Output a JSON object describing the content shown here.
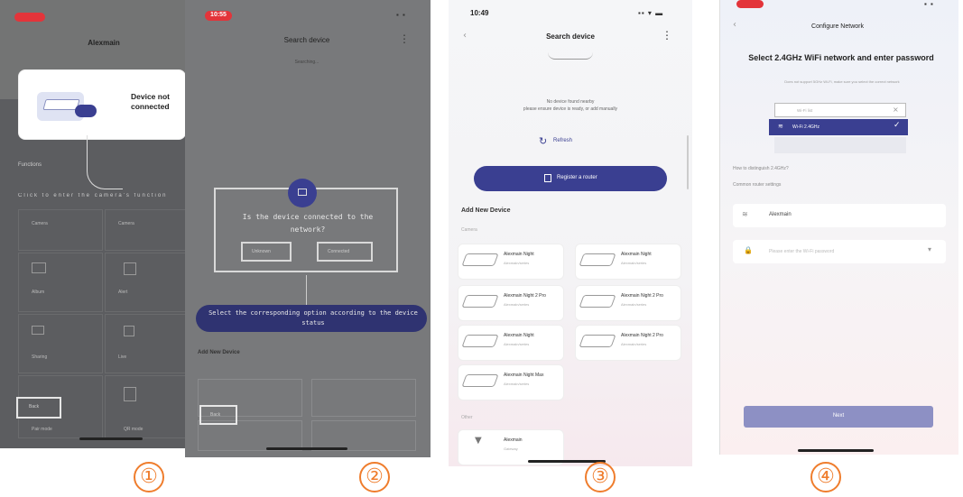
{
  "panel1": {
    "header_title": "Alexmain",
    "popup_title": "Device not connected",
    "section_title": "Functions",
    "hint": "Click to enter the camera's function",
    "tiles": [
      "Camera",
      "Camera",
      "Album",
      "Alert",
      "Sharing",
      "Live",
      "Pair mode",
      "QR mode"
    ],
    "small_button": "Back"
  },
  "panel2": {
    "status_time": "10:55",
    "header_title": "Search device",
    "sub_text": "Searching...",
    "dialog_question": "Is the device connected to the network?",
    "dialog_left": "Unknown",
    "dialog_right": "Connected",
    "tip": "Select the corresponding option according to the device status",
    "add_section": "Add New Device",
    "small_button": "Back"
  },
  "panel3": {
    "status_time": "10:49",
    "header_title": "Search device",
    "empty_text_1": "No device found nearby",
    "empty_text_2": "please ensure device is ready, or add manually",
    "refresh_label": "Refresh",
    "register_button": "Register a router",
    "add_section": "Add New Device",
    "category_camera": "Camera",
    "category_other": "Other",
    "devices": [
      {
        "name": "Alexmain Night",
        "sub": "Alexmain/series"
      },
      {
        "name": "Alexmain Night",
        "sub": "Alexmain/series"
      },
      {
        "name": "Alexmain Night 2 Pro",
        "sub": "Alexmain/series"
      },
      {
        "name": "Alexmain Night 2 Pro",
        "sub": "Alexmain/series"
      },
      {
        "name": "Alexmain Night",
        "sub": "Alexmain/series"
      },
      {
        "name": "Alexmain Night 2 Pro",
        "sub": "Alexmain/series"
      },
      {
        "name": "Alexmain Night Max",
        "sub": "Alexmain/series"
      }
    ],
    "other_device": {
      "name": "Alexmain",
      "sub": "Gateway"
    }
  },
  "panel4": {
    "header_title": "Configure Network",
    "heading": "Select 2.4GHz WiFi network and enter password",
    "sub_text": "Does not support 5GHz Wi-Fi, make sure you select the correct network",
    "dropdown_placeholder": "Wi-Fi list",
    "selected_network": "Wi-Fi 2.4GHz",
    "link1": "How to distinguish 2.4GHz?",
    "link2": "Common router settings",
    "wifi_name": "Alexmain",
    "password_placeholder": "Please enter the Wi-Fi password",
    "next_button": "Next"
  },
  "steps": [
    "①",
    "②",
    "③",
    "④"
  ],
  "colors": {
    "accent": "#3a3f91",
    "step_orange": "#ef7d2d",
    "status_red": "#e3343a"
  }
}
